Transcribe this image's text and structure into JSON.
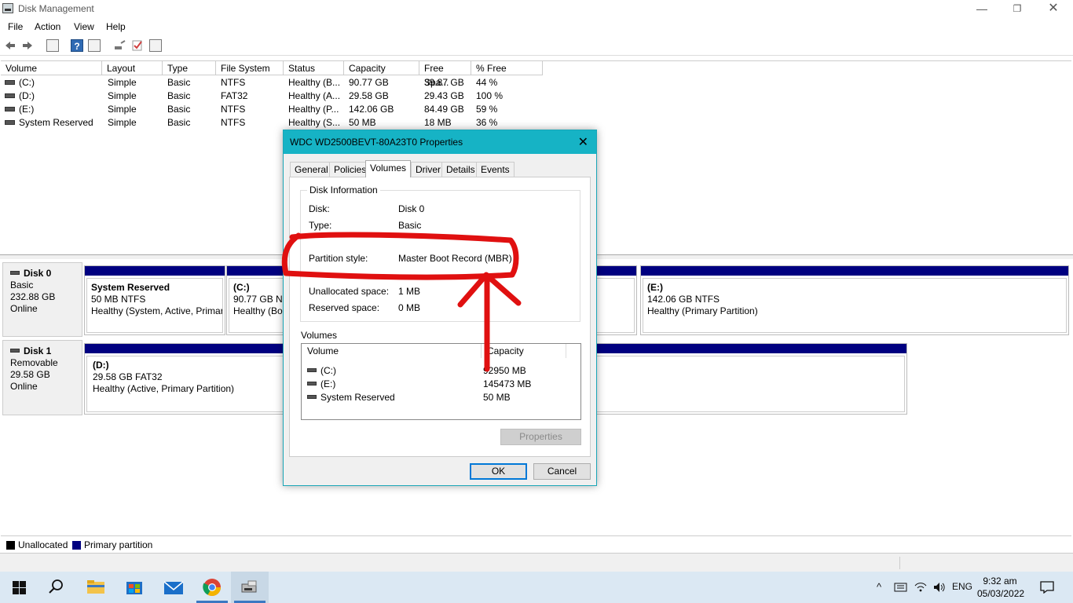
{
  "window": {
    "title": "Disk Management",
    "min_glyph": "—",
    "max_glyph": "❐",
    "close_glyph": "✕"
  },
  "menu": {
    "file": "File",
    "action": "Action",
    "view": "View",
    "help": "Help"
  },
  "toolbar": {
    "back_icon": "arrow-left-icon",
    "forward_icon": "arrow-right-icon",
    "help_glyph": "?"
  },
  "volume_list": {
    "columns": [
      "Volume",
      "Layout",
      "Type",
      "File System",
      "Status",
      "Capacity",
      "Free Spa...",
      "% Free"
    ],
    "rows": [
      {
        "volume": "(C:)",
        "layout": "Simple",
        "type": "Basic",
        "fs": "NTFS",
        "status": "Healthy (B...",
        "capacity": "90.77 GB",
        "free": "39.87 GB",
        "pct": "44 %"
      },
      {
        "volume": "(D:)",
        "layout": "Simple",
        "type": "Basic",
        "fs": "FAT32",
        "status": "Healthy (A...",
        "capacity": "29.58 GB",
        "free": "29.43 GB",
        "pct": "100 %"
      },
      {
        "volume": "(E:)",
        "layout": "Simple",
        "type": "Basic",
        "fs": "NTFS",
        "status": "Healthy (P...",
        "capacity": "142.06 GB",
        "free": "84.49 GB",
        "pct": "59 %"
      },
      {
        "volume": "System Reserved",
        "layout": "Simple",
        "type": "Basic",
        "fs": "NTFS",
        "status": "Healthy (S...",
        "capacity": "50 MB",
        "free": "18 MB",
        "pct": "36 %"
      }
    ]
  },
  "disks": [
    {
      "name": "Disk 0",
      "kind": "Basic",
      "size": "232.88 GB",
      "state": "Online",
      "partitions": [
        {
          "name": "System Reserved",
          "size": "50 MB NTFS",
          "status": "Healthy (System, Active, Primar"
        },
        {
          "name": "(C:)",
          "size": "90.77 GB NTI",
          "status": "Healthy (Boo"
        },
        {
          "name": "(E:)",
          "size": "142.06 GB NTFS",
          "status": "Healthy (Primary Partition)"
        }
      ]
    },
    {
      "name": "Disk 1",
      "kind": "Removable",
      "size": "29.58 GB",
      "state": "Online",
      "partitions": [
        {
          "name": "(D:)",
          "size": "29.58 GB FAT32",
          "status": "Healthy (Active, Primary Partition)"
        }
      ]
    }
  ],
  "legend": {
    "unallocated": "Unallocated",
    "primary": "Primary partition",
    "unallocated_color": "#000000",
    "primary_color": "#000080"
  },
  "dialog": {
    "title": "WDC WD2500BEVT-80A23T0 Properties",
    "close_glyph": "✕",
    "tabs": [
      "General",
      "Policies",
      "Volumes",
      "Driver",
      "Details",
      "Events"
    ],
    "active_tab": "Volumes",
    "group_title": "Disk Information",
    "info": [
      {
        "k": "Disk:",
        "v": "Disk 0"
      },
      {
        "k": "Type:",
        "v": "Basic"
      },
      {
        "k": "Partition style:",
        "v": "Master Boot Record (MBR)"
      },
      {
        "k": "Unallocated space:",
        "v": "1 MB"
      },
      {
        "k": "Reserved space:",
        "v": "0 MB"
      }
    ],
    "volumes_label": "Volumes",
    "volume_columns": [
      "Volume",
      "Capacity"
    ],
    "volumes": [
      {
        "name": "(C:)",
        "capacity": "92950 MB"
      },
      {
        "name": "(E:)",
        "capacity": "145473 MB"
      },
      {
        "name": "System Reserved",
        "capacity": "50 MB"
      }
    ],
    "properties_button": "Properties",
    "ok_button": "OK",
    "cancel_button": "Cancel",
    "annotation_color": "#e01010"
  },
  "taskbar": {
    "search_icon": "search-icon",
    "language": "ENG",
    "time": "9:32 am",
    "date": "05/03/2022",
    "tray_chevron": "^"
  }
}
